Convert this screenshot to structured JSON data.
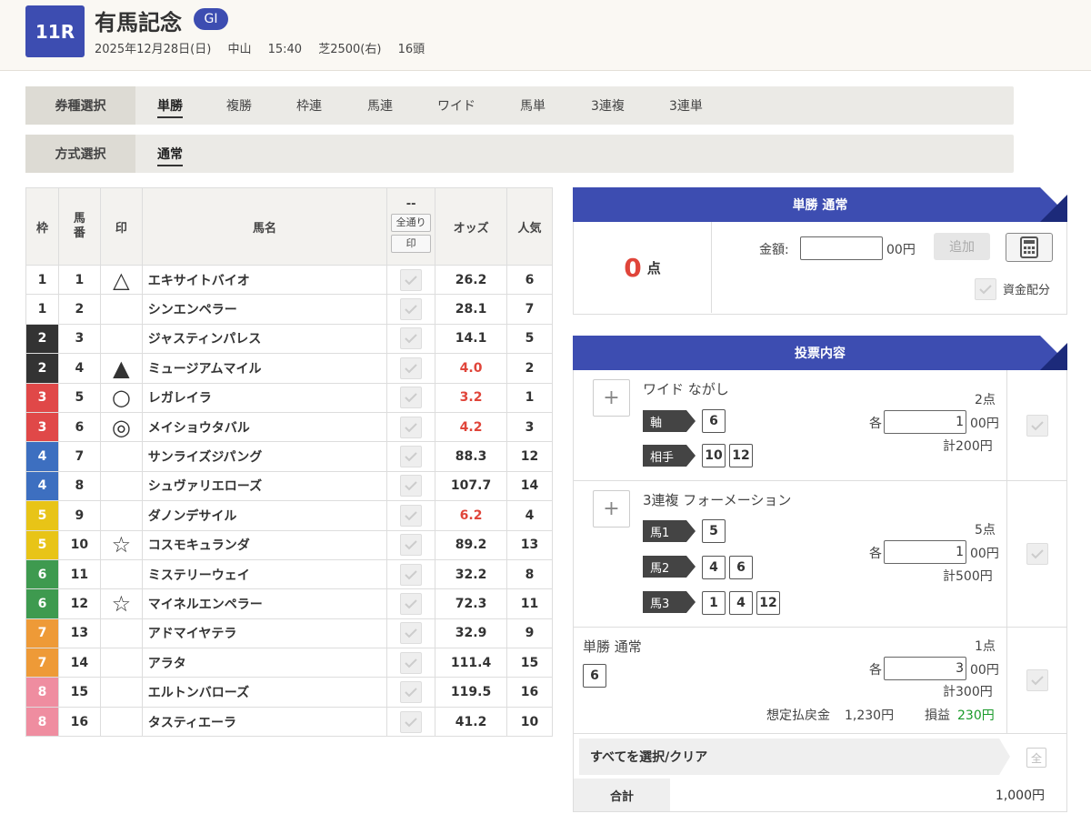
{
  "header": {
    "race_no": "11R",
    "race_name": "有馬記念",
    "grade": "GⅠ",
    "date": "2025年12月28日(日)",
    "venue": "中山",
    "time": "15:40",
    "course": "芝2500(右)",
    "runners": "16頭"
  },
  "bet_type_bar": {
    "label": "券種選択",
    "options": [
      "単勝",
      "複勝",
      "枠連",
      "馬連",
      "ワイド",
      "馬単",
      "3連複",
      "3連単"
    ],
    "active": "単勝"
  },
  "method_bar": {
    "label": "方式選択",
    "options": [
      "通常"
    ],
    "active": "通常"
  },
  "table": {
    "headers": {
      "waku": "枠",
      "umaban": "馬番",
      "mark": "印",
      "name": "馬名",
      "check_top": "--",
      "all_btn": "全通り",
      "mark_btn": "印",
      "odds": "オッズ",
      "pop": "人気"
    },
    "rows": [
      {
        "waku": "1",
        "no": "1",
        "mark": "△",
        "name": "エキサイトバイオ",
        "odds": "26.2",
        "pop": "6",
        "hot": false
      },
      {
        "waku": "1",
        "no": "2",
        "mark": "",
        "name": "シンエンペラー",
        "odds": "28.1",
        "pop": "7",
        "hot": false
      },
      {
        "waku": "2",
        "no": "3",
        "mark": "",
        "name": "ジャスティンパレス",
        "odds": "14.1",
        "pop": "5",
        "hot": false
      },
      {
        "waku": "2",
        "no": "4",
        "mark": "▲",
        "name": "ミュージアムマイル",
        "odds": "4.0",
        "pop": "2",
        "hot": true
      },
      {
        "waku": "3",
        "no": "5",
        "mark": "○",
        "name": "レガレイラ",
        "odds": "3.2",
        "pop": "1",
        "hot": true
      },
      {
        "waku": "3",
        "no": "6",
        "mark": "◎",
        "name": "メイショウタバル",
        "odds": "4.2",
        "pop": "3",
        "hot": true
      },
      {
        "waku": "4",
        "no": "7",
        "mark": "",
        "name": "サンライズジパング",
        "odds": "88.3",
        "pop": "12",
        "hot": false
      },
      {
        "waku": "4",
        "no": "8",
        "mark": "",
        "name": "シュヴァリエローズ",
        "odds": "107.7",
        "pop": "14",
        "hot": false
      },
      {
        "waku": "5",
        "no": "9",
        "mark": "",
        "name": "ダノンデサイル",
        "odds": "6.2",
        "pop": "4",
        "hot": true
      },
      {
        "waku": "5",
        "no": "10",
        "mark": "☆",
        "name": "コスモキュランダ",
        "odds": "89.2",
        "pop": "13",
        "hot": false
      },
      {
        "waku": "6",
        "no": "11",
        "mark": "",
        "name": "ミステリーウェイ",
        "odds": "32.2",
        "pop": "8",
        "hot": false
      },
      {
        "waku": "6",
        "no": "12",
        "mark": "☆",
        "name": "マイネルエンペラー",
        "odds": "72.3",
        "pop": "11",
        "hot": false
      },
      {
        "waku": "7",
        "no": "13",
        "mark": "",
        "name": "アドマイヤテラ",
        "odds": "32.9",
        "pop": "9",
        "hot": false
      },
      {
        "waku": "7",
        "no": "14",
        "mark": "",
        "name": "アラタ",
        "odds": "111.4",
        "pop": "15",
        "hot": false
      },
      {
        "waku": "8",
        "no": "15",
        "mark": "",
        "name": "エルトンバローズ",
        "odds": "119.5",
        "pop": "16",
        "hot": false
      },
      {
        "waku": "8",
        "no": "16",
        "mark": "",
        "name": "タスティエーラ",
        "odds": "41.2",
        "pop": "10",
        "hot": false
      }
    ],
    "waku_colors": {
      "1": "#ffffff",
      "2": "#333333",
      "3": "#e04848",
      "4": "#3d6fc0",
      "5": "#e8c417",
      "6": "#3e9a4f",
      "7": "#ee9a37",
      "8": "#ef8da0"
    }
  },
  "bet_panel": {
    "title": "単勝 通常",
    "points": "0",
    "points_unit": "点",
    "amount_label": "金額:",
    "amount_value": "",
    "amount_unit": "00円",
    "add_button": "追加",
    "calculator_icon": "calculator-icon",
    "fund_label": "資金配分"
  },
  "slip": {
    "title": "投票内容",
    "entries": [
      {
        "type": "ワイド ながし",
        "rows": [
          {
            "label": "軸",
            "nums": [
              "6"
            ]
          },
          {
            "label": "相手",
            "nums": [
              "10",
              "12"
            ]
          }
        ],
        "points": "2点",
        "each": "各",
        "amount": "1",
        "amount_unit": "00円",
        "total": "計200円"
      },
      {
        "type": "3連複 フォーメーション",
        "rows": [
          {
            "label": "馬1",
            "nums": [
              "5"
            ]
          },
          {
            "label": "馬2",
            "nums": [
              "4",
              "6"
            ]
          },
          {
            "label": "馬3",
            "nums": [
              "1",
              "4",
              "12"
            ]
          }
        ],
        "points": "5点",
        "each": "各",
        "amount": "1",
        "amount_unit": "00円",
        "total": "計500円"
      },
      {
        "type": "単勝 通常",
        "nums": [
          "6"
        ],
        "points": "1点",
        "each": "各",
        "amount": "3",
        "amount_unit": "00円",
        "total": "計300円",
        "payout_label": "想定払戻金",
        "payout": "1,230円",
        "profit_label": "損益",
        "profit": "230円"
      }
    ],
    "select_all": "すべてを選択/クリア",
    "select_all_btn": "全",
    "total_label": "合計",
    "total_value": "1,000円"
  }
}
